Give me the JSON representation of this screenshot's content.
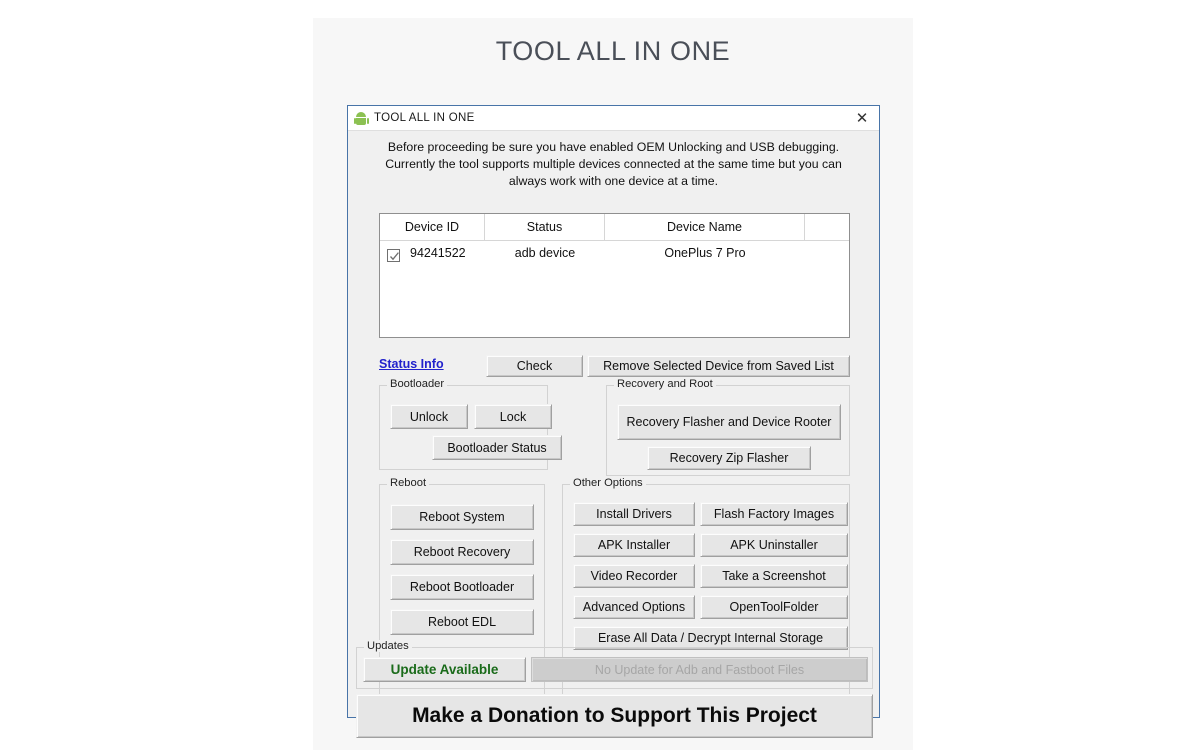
{
  "page": {
    "heading": "TOOL ALL IN ONE"
  },
  "window": {
    "icon": "android-robot-icon",
    "title": "TOOL ALL IN ONE",
    "close_label": "✕"
  },
  "notice": {
    "line1": "Before proceeding be sure you have enabled OEM Unlocking and USB debugging.",
    "line2": "Currently the tool supports multiple devices connected at the same time but you can",
    "line3": "always work with one device at a time."
  },
  "device_table": {
    "columns": [
      "Device ID",
      "Status",
      "Device Name"
    ],
    "rows": [
      {
        "checked": true,
        "device_id": "94241522",
        "status": "adb device",
        "device_name": "OnePlus 7 Pro"
      }
    ]
  },
  "status_row": {
    "status_info_link": "Status Info",
    "check_button": "Check",
    "remove_button": "Remove Selected Device from Saved List"
  },
  "bootloader": {
    "legend": "Bootloader",
    "unlock": "Unlock",
    "lock": "Lock",
    "status": "Bootloader Status"
  },
  "recovery": {
    "legend": "Recovery and Root",
    "flasher_rooter": "Recovery Flasher and Device Rooter",
    "zip_flasher": "Recovery Zip Flasher"
  },
  "reboot": {
    "legend": "Reboot",
    "buttons": [
      "Reboot System",
      "Reboot Recovery",
      "Reboot Bootloader",
      "Reboot EDL"
    ]
  },
  "other_options": {
    "legend": "Other Options",
    "install_drivers": "Install Drivers",
    "flash_factory_images": "Flash Factory Images",
    "apk_installer": "APK Installer",
    "apk_uninstaller": "APK Uninstaller",
    "video_recorder": "Video Recorder",
    "take_screenshot": "Take a Screenshot",
    "advanced_options": "Advanced Options",
    "open_tool_folder": "OpenToolFolder",
    "erase_all_data": "Erase All Data / Decrypt Internal Storage"
  },
  "updates": {
    "legend": "Updates",
    "update_available": "Update Available",
    "no_update": "No Update for Adb and Fastboot Files"
  },
  "donation": {
    "label": "Make a Donation to Support This Project"
  },
  "colors": {
    "window_border": "#4874a8",
    "link": "#2222cc",
    "update_green": "#1a6b1a",
    "android_green": "#8cc152",
    "panel_bg": "#f7f7f7",
    "dialog_bg": "#f0f0f0"
  }
}
